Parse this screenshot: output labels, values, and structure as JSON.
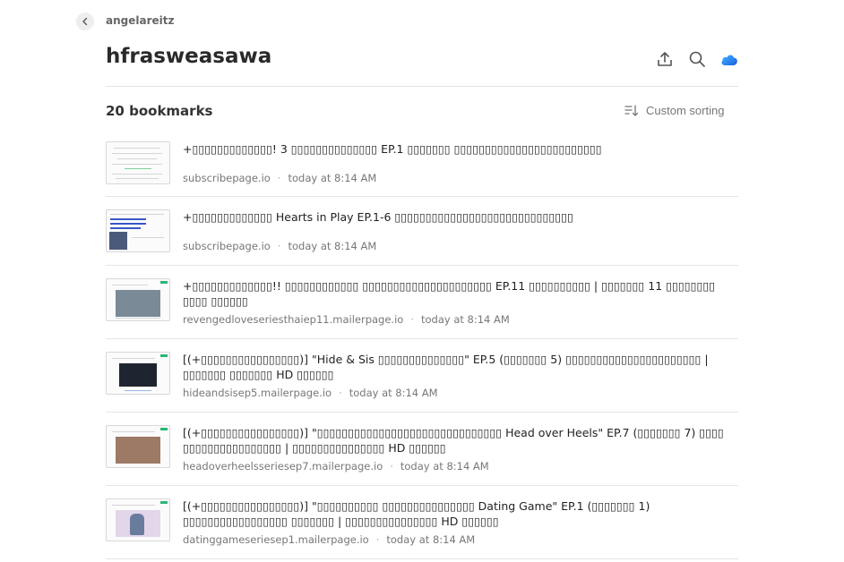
{
  "header": {
    "owner": "angelareitz",
    "collection_title": "hfrasweasawa",
    "icons": [
      "back-chevron-icon",
      "upload-icon",
      "search-icon",
      "cloud-icon"
    ]
  },
  "toolbar": {
    "count_label": "20 bookmarks",
    "sort_label": "Custom sorting"
  },
  "bookmarks": [
    {
      "title": "+▯▯▯▯▯▯▯▯▯▯▯▯▯! 3 ▯▯▯▯▯▯▯▯▯▯▯▯▯▯ EP.1 ▯▯▯▯▯▯▯ ▯▯▯▯▯▯▯▯▯▯▯▯▯▯▯▯▯▯▯▯▯▯▯▯",
      "domain": "subscribepage.io",
      "time": "today at 8:14 AM"
    },
    {
      "title": "+▯▯▯▯▯▯▯▯▯▯▯▯▯ Hearts in Play EP.1-6 ▯▯▯▯▯▯▯▯▯▯▯▯▯▯▯▯▯▯▯▯▯▯▯▯▯▯▯▯▯",
      "domain": "subscribepage.io",
      "time": "today at 8:14 AM"
    },
    {
      "title": "+▯▯▯▯▯▯▯▯▯▯▯▯▯!! ▯▯▯▯▯▯▯▯▯▯▯▯ ▯▯▯▯▯▯▯▯▯▯▯▯▯▯▯▯▯▯▯▯▯ EP.11 ▯▯▯▯▯▯▯▯▯▯ | ▯▯▯▯▯▯▯ 11 ▯▯▯▯▯▯▯▯ ▯▯▯▯ ▯▯▯▯▯▯",
      "domain": "revengedloveseriesthaiep11.mailerpage.io",
      "time": "today at 8:14 AM"
    },
    {
      "title": "[(+▯▯▯▯▯▯▯▯▯▯▯▯▯▯▯▯)] \"Hide & Sis ▯▯▯▯▯▯▯▯▯▯▯▯▯▯\" EP.5 (▯▯▯▯▯▯▯ 5) ▯▯▯▯▯▯▯▯▯▯▯▯▯▯▯▯▯▯▯▯▯▯ | ▯▯▯▯▯▯▯ ▯▯▯▯▯▯▯ HD ▯▯▯▯▯▯",
      "domain": "hideandsisep5.mailerpage.io",
      "time": "today at 8:14 AM"
    },
    {
      "title": "[(+▯▯▯▯▯▯▯▯▯▯▯▯▯▯▯▯)] \"▯▯▯▯▯▯▯▯▯▯▯▯▯▯▯▯▯▯▯▯▯▯▯▯▯▯▯▯▯▯ Head over Heels\" EP.7 (▯▯▯▯▯▯▯ 7) ▯▯▯▯ ▯▯▯▯▯▯▯▯▯▯▯▯▯▯▯▯ | ▯▯▯▯▯▯▯▯▯▯▯▯▯▯▯ HD ▯▯▯▯▯▯",
      "domain": "headoverheelsseriesep7.mailerpage.io",
      "time": "today at 8:14 AM"
    },
    {
      "title": "[(+▯▯▯▯▯▯▯▯▯▯▯▯▯▯▯▯)] \"▯▯▯▯▯▯▯▯▯▯ ▯▯▯▯▯▯▯▯▯▯▯▯▯▯▯ Dating Game\" EP.1 (▯▯▯▯▯▯▯ 1) ▯▯▯▯▯▯▯▯▯▯▯▯▯▯▯▯▯ ▯▯▯▯▯▯▯ | ▯▯▯▯▯▯▯▯▯▯▯▯▯▯▯ HD ▯▯▯▯▯▯",
      "domain": "datinggameseriesep1.mailerpage.io",
      "time": "today at 8:14 AM"
    }
  ]
}
